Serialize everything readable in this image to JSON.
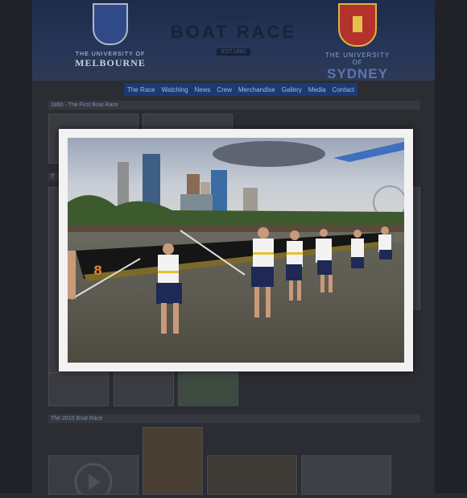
{
  "header": {
    "melbourne": {
      "line1": "THE UNIVERSITY OF",
      "line2": "MELBOURNE"
    },
    "race": {
      "line1": "The Australian",
      "line2": "BOAT RACE",
      "est": "EST.1860"
    },
    "sydney": {
      "line1": "THE UNIVERSITY OF",
      "line2": "SYDNEY"
    }
  },
  "nav": {
    "items": [
      "The Race",
      "Watching",
      "News",
      "Crew",
      "Merchandise",
      "Gallery",
      "Media",
      "Contact"
    ]
  },
  "sections": {
    "first": "1860 - The First Boat Race",
    "second": "T",
    "third": "The 2010 Boat Race"
  },
  "colors": {
    "nav_bg": "#1b3a73",
    "page_bg": "#2b2d33",
    "lightbox_frame": "#f2f2f2"
  }
}
